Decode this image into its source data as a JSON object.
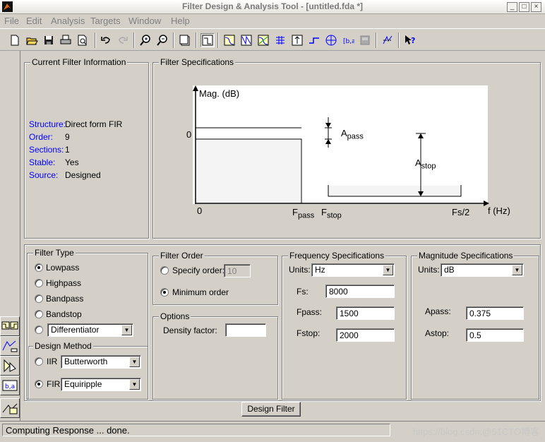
{
  "window": {
    "title": "Filter Design & Analysis Tool - [untitled.fda *]",
    "controls": [
      "_",
      "□",
      "×"
    ]
  },
  "menu": {
    "items": [
      {
        "label": "File"
      },
      {
        "label": "Edit"
      },
      {
        "label": "Analysis"
      },
      {
        "label": "Targets"
      },
      {
        "label": "Window"
      },
      {
        "label": "Help"
      }
    ]
  },
  "toolbar": {
    "icons": [
      "new-icon",
      "open-icon",
      "save-icon",
      "print-icon",
      "print-preview-icon",
      "undo-icon",
      "redo-icon",
      "zoom-in-icon",
      "zoom-out-icon",
      "full-view-icon",
      "filter-specs-icon",
      "magnitude-response-icon",
      "phase-response-icon",
      "mag-phase-icon",
      "group-delay-icon",
      "impulse-response-icon",
      "step-response-icon",
      "pole-zero-icon",
      "filter-coefficients-icon",
      "filter-info-icon",
      "legend-icon",
      "whats-this-icon"
    ]
  },
  "current_filter": {
    "title": "Current Filter Information",
    "rows": [
      {
        "label": "Structure:",
        "value": "Direct form FIR"
      },
      {
        "label": "Order:",
        "value": "9"
      },
      {
        "label": "Sections:",
        "value": "1"
      },
      {
        "label": "Stable:",
        "value": "Yes"
      },
      {
        "label": "Source:",
        "value": "Designed"
      }
    ]
  },
  "filter_specs": {
    "title": "Filter Specifications",
    "ylabel": "Mag. (dB)",
    "zero_y": "0",
    "zero_x": "0",
    "f_pass": "F",
    "f_pass_sub": "pass",
    "f_stop": "F",
    "f_stop_sub": "stop",
    "fs_half": "Fs/2",
    "xlabel": "f (Hz)",
    "a_pass": "A",
    "a_pass_sub": "pass",
    "a_stop": "A",
    "a_stop_sub": "stop"
  },
  "filter_type": {
    "title": "Filter Type",
    "options": [
      {
        "label": "Lowpass",
        "selected": true
      },
      {
        "label": "Highpass",
        "selected": false
      },
      {
        "label": "Bandpass",
        "selected": false
      },
      {
        "label": "Bandstop",
        "selected": false
      }
    ],
    "other_select": "Differentiator"
  },
  "design_method": {
    "title": "Design Method",
    "iir_label": "IIR",
    "iir_select": "Butterworth",
    "fir_label": "FIR",
    "fir_select": "Equiripple"
  },
  "filter_order": {
    "title": "Filter Order",
    "specify_label": "Specify order:",
    "specify_value": "10",
    "minimum_label": "Minimum order"
  },
  "options": {
    "title": "Options",
    "density_label": "Density factor:",
    "density_value": ""
  },
  "freq_specs": {
    "title": "Frequency Specifications",
    "units_label": "Units:",
    "units_value": "Hz",
    "fs_label": "Fs:",
    "fs_value": "8000",
    "fpass_label": "Fpass:",
    "fpass_value": "1500",
    "fstop_label": "Fstop:",
    "fstop_value": "2000"
  },
  "mag_specs": {
    "title": "Magnitude Specifications",
    "units_label": "Units:",
    "units_value": "dB",
    "apass_label": "Apass:",
    "apass_value": "0.375",
    "astop_label": "Astop:",
    "astop_value": "0.5"
  },
  "design_button": "Design Filter",
  "status": {
    "text": "Computing Response ... done.",
    "watermark": "https://blog.csdn.@51CTO博客"
  }
}
